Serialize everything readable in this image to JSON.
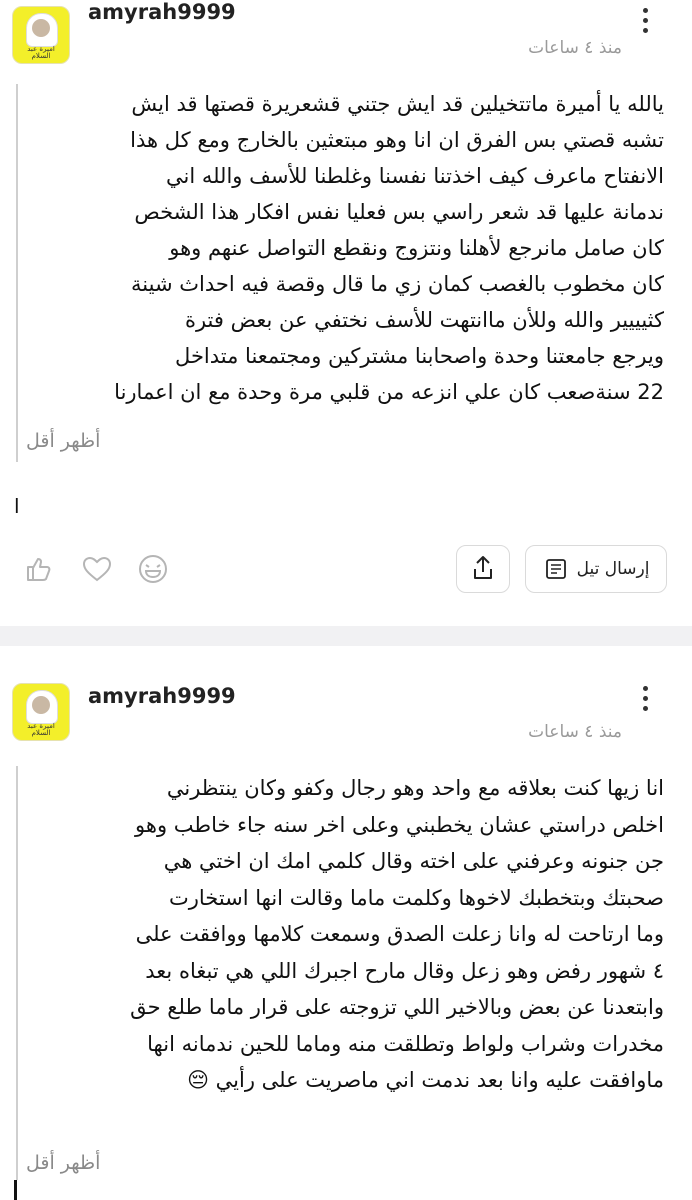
{
  "posts": [
    {
      "username": "amyrah9999",
      "timestamp": "منذ ٤ ساعات",
      "avatar_caption": "أميرة عبد السلام",
      "lines": [
        "يالله يا أميرة ماتتخيلين قد ايش جتني قشعريرة قصتها قد ايش",
        "تشبه قصتي بس الفرق ان انا وهو مبتعثين بالخارج ومع كل هذا",
        "الانفتاح ماعرف كيف اخذتنا نفسنا وغلطنا للأسف والله اني",
        "ندمانة عليها قد شعر راسي بس فعليا نفس افكار هذا الشخص",
        "كان صامل مانرجع لأهلنا ونتزوج ونقطع التواصل عنهم وهو",
        "كان مخطوب بالغصب كمان زي ما قال وقصة فيه احداث شينة",
        "كثيييير والله وللأن ماانتهت للأسف نختفي عن بعض فترة",
        "ويرجع جامعتنا وحدة واصحابنا مشتركين ومجتمعنا متداخل",
        "22 سنةصعب كان علي انزعه من قلبي مرة وحدة مع ان اعمارنا"
      ],
      "show_less": "أظهر أقل",
      "trailing": "ا",
      "send_label": "إرسال تيل"
    },
    {
      "username": "amyrah9999",
      "timestamp": "منذ ٤ ساعات",
      "avatar_caption": "أميرة عبد السلام",
      "lines": [
        "انا زيها كنت بعلاقه مع واحد وهو رجال وكفو وكان ينتظرني",
        "اخلص دراستي عشان يخطبني وعلى اخر سنه جاء خاطب وهو",
        "جن جنونه وعرفني على اخته وقال كلمي امك ان اختي هي",
        "صحبتك وبتخطبك لاخوها وكلمت ماما وقالت انها استخارت",
        "وما ارتاحت له وانا زعلت الصدق وسمعت كلامها ووافقت على",
        "٤ شهور رفض وهو زعل وقال مارح اجبرك اللي هي تبغاه بعد",
        "وابتعدنا عن بعض وبالاخير اللي تزوجته على قرار ماما طلع حق",
        "مخدرات وشراب ولواط وتطلقت منه وماما للحين ندمانه انها",
        "ماوافقت عليه وانا بعد ندمت اني ماصريت على رأيي 😔"
      ],
      "show_less": "أظهر أقل"
    }
  ],
  "icons": {
    "more": "more-vertical-icon",
    "like": "thumbs-up-icon",
    "heart": "heart-icon",
    "laugh": "laughing-face-icon",
    "share": "share-upload-icon",
    "scroll": "scroll-icon"
  },
  "colors": {
    "avatar_bg": "#f3ef2a",
    "muted_text": "#9a9a9a",
    "separator": "#f1f1f3"
  }
}
